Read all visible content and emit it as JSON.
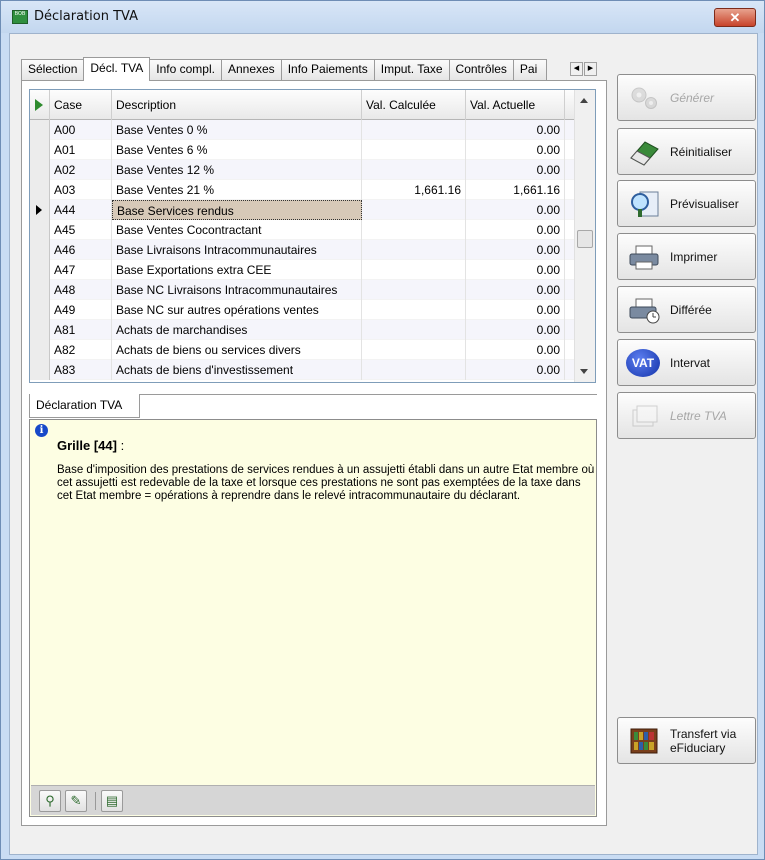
{
  "window": {
    "title": "Déclaration TVA",
    "app_icon_text": "BOB"
  },
  "tabs": [
    "Sélection",
    "Décl. TVA",
    "Info compl.",
    "Annexes",
    "Info Paiements",
    "Imput. Taxe",
    "Contrôles",
    "Pai"
  ],
  "grid": {
    "columns": [
      "Case",
      "Description",
      "Val. Calculée",
      "Val. Actuelle"
    ],
    "rows": [
      {
        "case": "A00",
        "desc": "Base  Ventes 0 %",
        "calc": "",
        "act": "0.00"
      },
      {
        "case": "A01",
        "desc": "Base  Ventes 6 %",
        "calc": "",
        "act": "0.00"
      },
      {
        "case": "A02",
        "desc": "Base  Ventes 12 %",
        "calc": "",
        "act": "0.00"
      },
      {
        "case": "A03",
        "desc": "Base  Ventes 21 %",
        "calc": "1,661.16",
        "act": "1,661.16"
      },
      {
        "case": "A44",
        "desc": "Base Services rendus",
        "calc": "",
        "act": "0.00",
        "selected": true
      },
      {
        "case": "A45",
        "desc": "Base  Ventes Cocontractant",
        "calc": "",
        "act": "0.00"
      },
      {
        "case": "A46",
        "desc": "Base  Livraisons Intracommunautaires",
        "calc": "",
        "act": "0.00"
      },
      {
        "case": "A47",
        "desc": "Base  Exportations extra CEE",
        "calc": "",
        "act": "0.00"
      },
      {
        "case": "A48",
        "desc": "Base  NC Livraisons Intracommunautaires",
        "calc": "",
        "act": "0.00"
      },
      {
        "case": "A49",
        "desc": "Base  NC sur autres opérations ventes",
        "calc": "",
        "act": "0.00"
      },
      {
        "case": "A81",
        "desc": "Achats de marchandises",
        "calc": "",
        "act": "0.00"
      },
      {
        "case": "A82",
        "desc": "Achats de biens ou services divers",
        "calc": "",
        "act": "0.00"
      },
      {
        "case": "A83",
        "desc": "Achats de biens d'investissement",
        "calc": "",
        "act": "0.00"
      }
    ]
  },
  "subtab": {
    "label": "Déclaration TVA"
  },
  "info": {
    "title": "Grille [44]",
    "title_suffix": " :",
    "body": "Base d'imposition des prestations de services rendues à un assujetti établi dans un autre Etat membre où cet assujetti est redevable de la taxe et lorsque ces prestations ne sont pas exemptées de la taxe dans cet Etat membre = opérations à reprendre dans le relevé intracommunautaire du déclarant."
  },
  "actions": {
    "generer": "Générer",
    "reinitialiser": "Réinitialiser",
    "previsualiser": "Prévisualiser",
    "imprimer": "Imprimer",
    "differee": "Différée",
    "intervat": "Intervat",
    "intervat_badge": "VAT",
    "lettre": "Lettre TVA",
    "transfert_line1": "Transfert via",
    "transfert_line2": "eFiduciary"
  },
  "colors": {
    "selected_row": "#d7c9b8",
    "info_background": "#fdfee3",
    "title_bar": "#c9dcf3",
    "close_button": "#c7432a"
  }
}
